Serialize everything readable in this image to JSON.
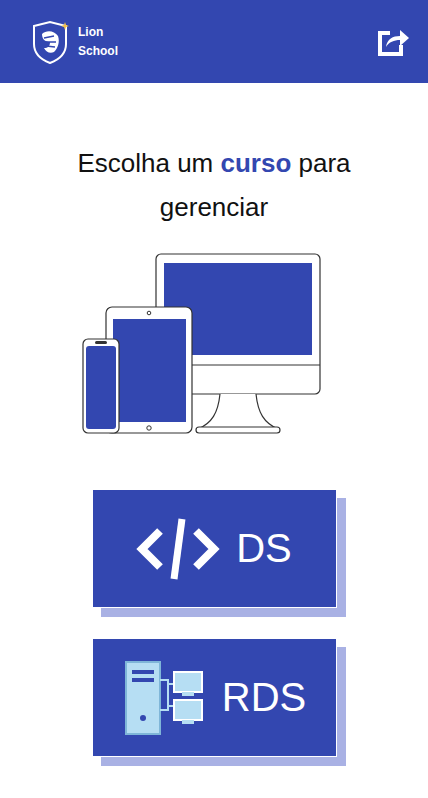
{
  "header": {
    "brand": [
      "Lion",
      "School"
    ]
  },
  "title": {
    "before": "Escolha um ",
    "highlight": "curso",
    "after": " para gerenciar"
  },
  "courses": [
    {
      "label": "DS",
      "kind": "code"
    },
    {
      "label": "RDS",
      "kind": "network"
    }
  ]
}
